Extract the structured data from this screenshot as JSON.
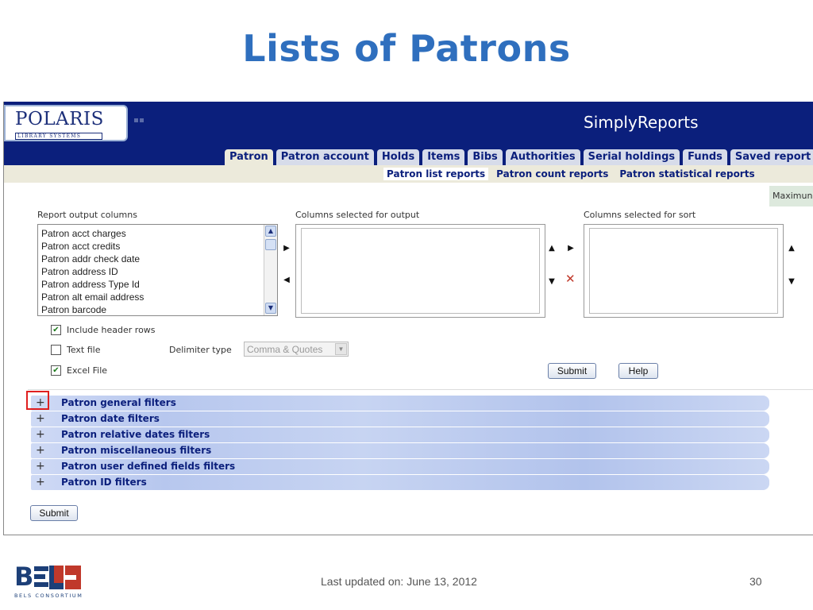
{
  "slide": {
    "title": "Lists of Patrons",
    "footer_date": "Last updated on: June 13, 2012",
    "page_number": "30",
    "logo_caption": "BELS CONSORTIUM"
  },
  "app": {
    "logo_text": "POLARIS",
    "logo_subtext": "LIBRARY SYSTEMS",
    "title": "SimplyReports"
  },
  "tabs": [
    {
      "label": "Patron",
      "active": true
    },
    {
      "label": "Patron account",
      "active": false
    },
    {
      "label": "Holds",
      "active": false
    },
    {
      "label": "Items",
      "active": false
    },
    {
      "label": "Bibs",
      "active": false
    },
    {
      "label": "Authorities",
      "active": false
    },
    {
      "label": "Serial holdings",
      "active": false
    },
    {
      "label": "Funds",
      "active": false
    },
    {
      "label": "Saved report",
      "active": false
    }
  ],
  "subtabs": [
    {
      "label": "Patron list reports",
      "active": true
    },
    {
      "label": "Patron count reports",
      "active": false
    },
    {
      "label": "Patron statistical reports",
      "active": false
    }
  ],
  "max_tab_label": "Maximun",
  "report_output": {
    "label": "Report output columns",
    "items": [
      "Patron acct charges",
      "Patron acct credits",
      "Patron addr check date",
      "Patron address ID",
      "Patron address Type Id",
      "Patron alt email address",
      "Patron barcode"
    ]
  },
  "columns_output": {
    "label": "Columns selected for output"
  },
  "columns_sort": {
    "label": "Columns selected for sort"
  },
  "options": {
    "include_header": {
      "label": "Include header rows",
      "checked": true
    },
    "text_file": {
      "label": "Text file",
      "checked": false
    },
    "delimiter_label": "Delimiter type",
    "delimiter_value": "Comma & Quotes",
    "excel_file": {
      "label": "Excel File",
      "checked": true
    }
  },
  "buttons": {
    "submit": "Submit",
    "help": "Help",
    "submit_bottom": "Submit"
  },
  "filters": [
    "Patron general filters",
    "Patron date filters",
    "Patron relative dates filters",
    "Patron miscellaneous filters",
    "Patron user defined fields filters",
    "Patron ID filters"
  ],
  "colors": {
    "title_blue": "#2f6fbe",
    "header_navy": "#0b1f7c",
    "highlight_red": "#e02020"
  }
}
